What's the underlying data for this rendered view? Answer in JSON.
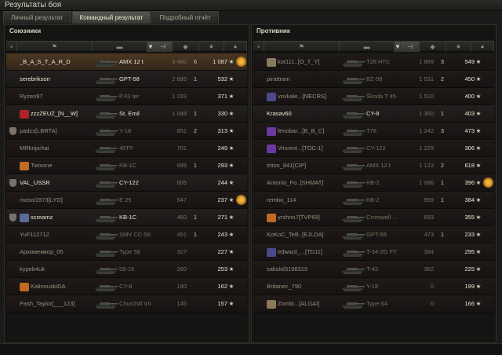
{
  "window": {
    "title": "Результаты боя"
  },
  "tabs": [
    {
      "label": "Личный результат",
      "active": false
    },
    {
      "label": "Командный результат",
      "active": true
    },
    {
      "label": "Подробный отчёт",
      "active": false
    }
  ],
  "allies": {
    "title": "Союзники",
    "rows": [
      {
        "name": "_B_A_S_T_A_R_D",
        "tank": "AMX 12 t",
        "damage": "3 480",
        "frags": "6",
        "xp": "1 087",
        "badge": "none",
        "medal": true,
        "highlight": "me",
        "alive": true
      },
      {
        "name": "serebrikson",
        "tank": "GPT-58",
        "damage": "2 685",
        "frags": "1",
        "xp": "532",
        "badge": "none",
        "medal": false,
        "alive": true
      },
      {
        "name": "Ryzen97",
        "tank": "P.43 ter",
        "damage": "1 233",
        "frags": "",
        "xp": "371",
        "badge": "none",
        "medal": false,
        "alive": false
      },
      {
        "name": "zzzZEUZ_[N__W]",
        "tank": "St. Emil",
        "damage": "1 048",
        "frags": "1",
        "xp": "330",
        "badge": "clan-red",
        "medal": false,
        "alive": true
      },
      {
        "name": "padzs[LBRTA]",
        "tank": "Y-18",
        "damage": "851",
        "frags": "2",
        "xp": "313",
        "badge": "shield",
        "medal": false,
        "alive": false
      },
      {
        "name": "MRkripchai",
        "tank": "45TP",
        "damage": "701",
        "frags": "",
        "xp": "249",
        "badge": "none",
        "medal": false,
        "alive": false
      },
      {
        "name": "Twixone",
        "tank": "KB-1C",
        "damage": "689",
        "frags": "1",
        "xp": "293",
        "badge": "clan-orange",
        "medal": false,
        "alive": false
      },
      {
        "name": "VAL_USSR",
        "tank": "CY-122",
        "damage": "605",
        "frags": "",
        "xp": "244",
        "badge": "shield",
        "medal": false,
        "alive": true
      },
      {
        "name": "mosol1973[LYD]",
        "tank": "E 25",
        "damage": "547",
        "frags": "",
        "xp": "237",
        "badge": "none",
        "medal": true,
        "alive": false
      },
      {
        "name": "screamz",
        "tank": "KB-1C",
        "damage": "460",
        "frags": "1",
        "xp": "271",
        "badge": "shield-clan",
        "medal": false,
        "alive": true
      },
      {
        "name": "YuF112712",
        "tank": "SMV CC-56",
        "damage": "451",
        "frags": "1",
        "xp": "243",
        "badge": "none",
        "medal": false,
        "alive": false
      },
      {
        "name": "Архимекмор_05",
        "tank": "Type 58",
        "damage": "327",
        "frags": "",
        "xp": "227",
        "badge": "none",
        "medal": false,
        "alive": false
      },
      {
        "name": "kypeb4uk",
        "tank": "59-16",
        "damage": "260",
        "frags": "",
        "xp": "253",
        "badge": "none",
        "medal": false,
        "alive": false
      },
      {
        "name": "KalinouskiDA",
        "tank": "CY-8",
        "damage": "190",
        "frags": "",
        "xp": "162",
        "badge": "clan-orange",
        "medal": false,
        "alive": false
      },
      {
        "name": "Pash_Taylor[___123]",
        "tank": "Churchill VII",
        "damage": "145",
        "frags": "",
        "xp": "157",
        "badge": "none",
        "medal": false,
        "alive": false
      }
    ]
  },
  "enemies": {
    "title": "Противник",
    "rows": [
      {
        "name": "kot111..[O_T_Y]",
        "tank": "T28 HTC",
        "damage": "1 899",
        "frags": "3",
        "xp": "549",
        "badge": "clan-diamond",
        "medal": false,
        "alive": false
      },
      {
        "name": "pirattram",
        "tank": "BZ-58",
        "damage": "1 531",
        "frags": "2",
        "xp": "450",
        "badge": "none",
        "medal": false,
        "alive": false
      },
      {
        "name": "vovkale...[NECRS]",
        "tank": "Škoda T 45",
        "damage": "1 510",
        "frags": "",
        "xp": "400",
        "badge": "clan-blade",
        "medal": false,
        "alive": false
      },
      {
        "name": "Krasav60",
        "tank": "CY-8",
        "damage": "1 350",
        "frags": "1",
        "xp": "403",
        "badge": "none",
        "medal": false,
        "alive": true
      },
      {
        "name": "fenobar...[B_B_C]",
        "tank": "T78",
        "damage": "1 242",
        "frags": "3",
        "xp": "473",
        "badge": "clan-purple",
        "medal": false,
        "alive": false
      },
      {
        "name": "Vincent...[TOC-1]",
        "tank": "CY-122",
        "damage": "1 225",
        "frags": "",
        "xp": "306",
        "badge": "clan-purple",
        "medal": false,
        "alive": false
      },
      {
        "name": "triton_841[CIP]",
        "tank": "AMX 12 t",
        "damage": "1 123",
        "frags": "2",
        "xp": "618",
        "badge": "none",
        "medal": false,
        "alive": false
      },
      {
        "name": "Antonio_Fo..[SHMAT]",
        "tank": "KB-2",
        "damage": "1 086",
        "frags": "1",
        "xp": "396",
        "badge": "none",
        "medal": true,
        "alive": false
      },
      {
        "name": "rembo_114",
        "tank": "KB-2",
        "damage": "959",
        "frags": "1",
        "xp": "384",
        "badge": "none",
        "medal": false,
        "alive": false
      },
      {
        "name": "yrshnn7[TVP69]",
        "tank": "Cromwell ...",
        "damage": "893",
        "frags": "",
        "xp": "355",
        "badge": "clan-orange",
        "medal": false,
        "alive": false
      },
      {
        "name": "KoKoC_TeB..[EJLDA]",
        "tank": "GPT-58",
        "damage": "473",
        "frags": "1",
        "xp": "233",
        "badge": "none",
        "medal": false,
        "alive": false
      },
      {
        "name": "edward_...[TD11]",
        "tank": "T-34-2G FT",
        "damage": "384",
        "frags": "",
        "xp": "295",
        "badge": "clan-blade",
        "medal": false,
        "alive": false
      },
      {
        "name": "sakslol3198315",
        "tank": "T-43",
        "damage": "362",
        "frags": "",
        "xp": "225",
        "badge": "none",
        "medal": false,
        "alive": false
      },
      {
        "name": "Britanec_790",
        "tank": "Y-18",
        "damage": "0",
        "frags": "",
        "xp": "199",
        "badge": "none",
        "medal": false,
        "alive": false
      },
      {
        "name": "Zombi...[ALGAI]",
        "tank": "Type 64",
        "damage": "0",
        "frags": "",
        "xp": "166",
        "badge": "clan-diamond",
        "medal": false,
        "alive": false
      }
    ]
  },
  "colors": {
    "me_row": "#4a3820",
    "medal": "#f0b43a"
  },
  "icons": {
    "star": "★",
    "headers": [
      "squad-icon",
      "player-icon",
      "vehicle-icon",
      "sort-icon",
      "damage-icon",
      "frags-icon",
      "xp-star-icon",
      "medal-icon"
    ]
  }
}
